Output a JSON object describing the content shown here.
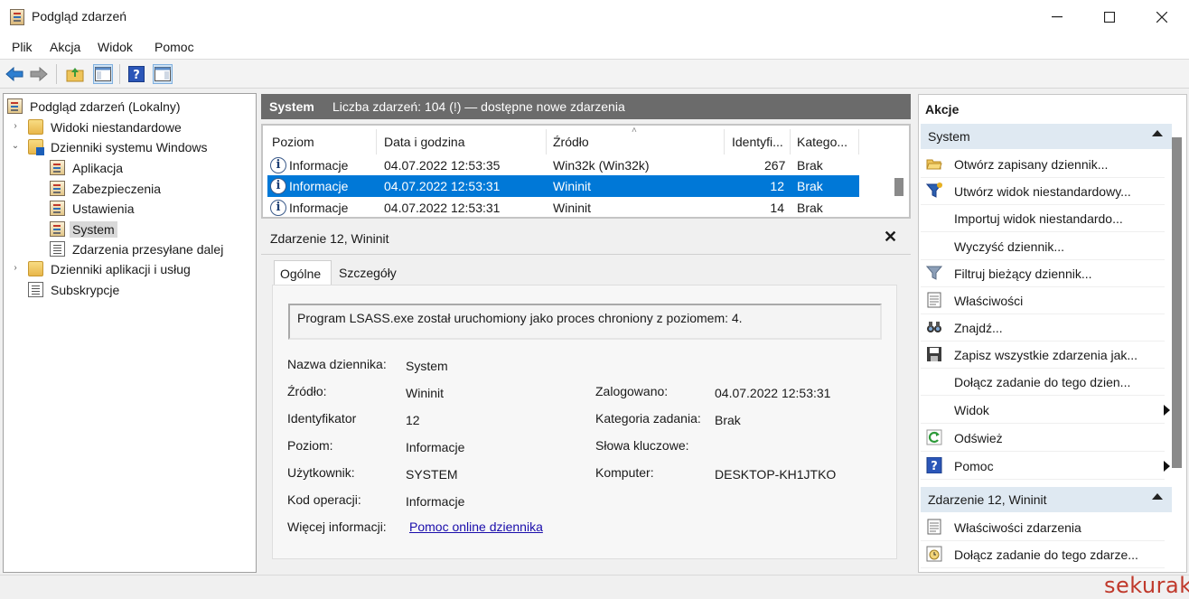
{
  "window": {
    "title": "Podgląd zdarzeń"
  },
  "menu": [
    "Plik",
    "Akcja",
    "Widok",
    "Pomoc"
  ],
  "tree": {
    "root": "Podgląd zdarzeń (Lokalny)",
    "custom_views": "Widoki niestandardowe",
    "windows_logs": "Dzienniki systemu Windows",
    "logs": [
      "Aplikacja",
      "Zabezpieczenia",
      "Ustawienia",
      "System",
      "Zdarzenia przesyłane dalej"
    ],
    "app_logs": "Dzienniki aplikacji i usług",
    "subscriptions": "Subskrypcje"
  },
  "center": {
    "title": "System",
    "count_text": "Liczba zdarzeń: 104 (!) — dostępne nowe zdarzenia",
    "columns": [
      "Poziom",
      "Data i godzina",
      "Źródło",
      "Identyfi...",
      "Katego..."
    ],
    "rows": [
      {
        "level": "Informacje",
        "date": "04.07.2022 12:53:35",
        "source": "Win32k (Win32k)",
        "id": "267",
        "category": "Brak"
      },
      {
        "level": "Informacje",
        "date": "04.07.2022 12:53:31",
        "source": "Wininit",
        "id": "12",
        "category": "Brak"
      },
      {
        "level": "Informacje",
        "date": "04.07.2022 12:53:31",
        "source": "Wininit",
        "id": "14",
        "category": "Brak"
      }
    ]
  },
  "details": {
    "title": "Zdarzenie 12, Wininit",
    "tabs": [
      "Ogólne",
      "Szczegóły"
    ],
    "message": "Program LSASS.exe został uruchomiony jako proces chroniony z poziomem: 4.",
    "fields": {
      "log_name_label": "Nazwa dziennika:",
      "log_name": "System",
      "source_label": "Źródło:",
      "source": "Wininit",
      "logged_label": "Zalogowano:",
      "logged": "04.07.2022 12:53:31",
      "id_label": "Identyfikator",
      "id": "12",
      "task_cat_label": "Kategoria zadania:",
      "task_cat": "Brak",
      "level_label": "Poziom:",
      "level": "Informacje",
      "keywords_label": "Słowa kluczowe:",
      "user_label": "Użytkownik:",
      "user": "SYSTEM",
      "computer_label": "Komputer:",
      "computer": "DESKTOP-KH1JTKO",
      "opcode_label": "Kod operacji:",
      "opcode": "Informacje",
      "more_info_label": "Więcej informacji:",
      "more_info_link": "Pomoc online dziennika"
    }
  },
  "actions": {
    "header": "Akcje",
    "section1": "System",
    "items1": [
      "Otwórz zapisany dziennik...",
      "Utwórz widok niestandardowy...",
      "Importuj widok niestandardo...",
      "Wyczyść dziennik...",
      "Filtruj bieżący dziennik...",
      "Właściwości",
      "Znajdź...",
      "Zapisz wszystkie zdarzenia jak...",
      "Dołącz zadanie do tego dzien...",
      "Widok",
      "Odśwież",
      "Pomoc"
    ],
    "section2": "Zdarzenie 12, Wininit",
    "items2": [
      "Właściwości zdarzenia",
      "Dołącz zadanie do tego zdarze..."
    ]
  },
  "watermark": "sekurak",
  "colors": {
    "selection": "#0078d7",
    "section_bg": "#dfe9f2",
    "header_bg": "#6b6b6b",
    "watermark": "#c0392b"
  }
}
